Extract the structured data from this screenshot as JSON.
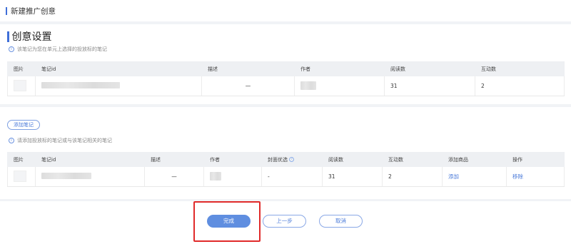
{
  "header": {
    "title": "新建推广创意"
  },
  "section": {
    "title": "创意设置",
    "note_hint": "该笔记为您在单元上选择的投放标的笔记",
    "related_hint": "请添加投放标的笔记或与该笔记相关的笔记",
    "add_note_label": "添加笔记"
  },
  "table1": {
    "headers": [
      "图片",
      "笔记id",
      "描述",
      "作者",
      "阅读数",
      "互动数"
    ],
    "row": {
      "description": "—",
      "reads": "31",
      "interactions": "2"
    }
  },
  "table2": {
    "headers": [
      "图片",
      "笔记id",
      "描述",
      "作者",
      "封面优选",
      "阅读数",
      "互动数",
      "添加商品",
      "操作"
    ],
    "row": {
      "description": "—",
      "cover": "-",
      "reads": "31",
      "interactions": "2",
      "add_product": "添加",
      "action": "移除"
    }
  },
  "footer": {
    "done_label": "完成",
    "prev_label": "上一步",
    "cancel_label": "取消"
  },
  "colors": {
    "accent": "#3f6fd8",
    "primary_button": "#5f8ee0",
    "highlight": "#e02a2a"
  }
}
